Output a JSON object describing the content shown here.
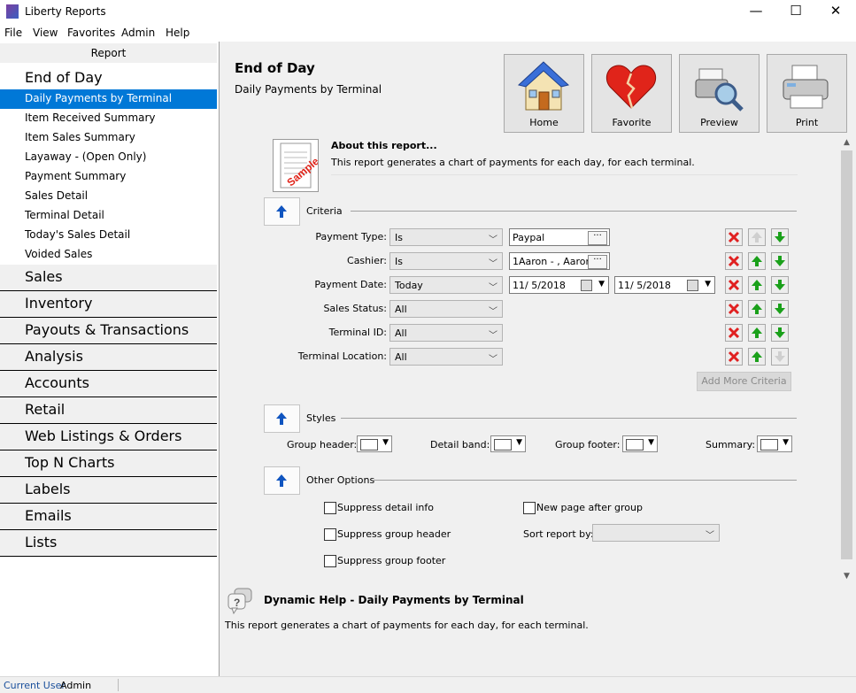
{
  "window": {
    "title": "Liberty Reports",
    "minimize": "—",
    "maximize": "☐",
    "close": "✕"
  },
  "menu": [
    "File",
    "View",
    "Favorites",
    "Admin",
    "Help"
  ],
  "sidebar": {
    "header": "Report",
    "category_open": "End of Day",
    "reports": [
      "Daily Payments by Terminal",
      "Item Received Summary",
      "Item Sales Summary",
      "Layaway - (Open Only)",
      "Payment Summary",
      "Sales Detail",
      "Terminal Detail",
      "Today's Sales Detail",
      "Voided Sales"
    ],
    "categories": [
      "Sales",
      "Inventory",
      "Payouts & Transactions",
      "Analysis",
      "Accounts",
      "Retail",
      "Web Listings & Orders",
      "Top N Charts",
      "Labels",
      "Emails",
      "Lists"
    ]
  },
  "header": {
    "title": "End of Day",
    "subtitle": "Daily Payments by Terminal"
  },
  "toolbar": {
    "home": "Home",
    "favorite": "Favorite",
    "preview": "Preview",
    "print": "Print"
  },
  "about": {
    "image_text": "Sample",
    "title": "About this report...",
    "text": "This report generates a chart of payments for each day, for each terminal."
  },
  "criteria": {
    "label": "Criteria",
    "rows": [
      {
        "label": "Payment Type:",
        "op": "Is",
        "value": "Paypal"
      },
      {
        "label": "Cashier:",
        "op": "Is",
        "value": "1Aaron - , Aaron"
      },
      {
        "label": "Payment Date:",
        "op": "Today",
        "date_from": "11/  5/2018",
        "date_to": "11/  5/2018"
      },
      {
        "label": "Sales Status:",
        "op": "All"
      },
      {
        "label": "Terminal ID:",
        "op": "All"
      },
      {
        "label": "Terminal Location:",
        "op": "All"
      }
    ],
    "add_more": "Add More Criteria"
  },
  "styles": {
    "label": "Styles",
    "group_header": "Group header:",
    "detail_band": "Detail band:",
    "group_footer": "Group footer:",
    "summary": "Summary:"
  },
  "options": {
    "label": "Other Options",
    "suppress_detail": "Suppress detail info",
    "suppress_group_header": "Suppress group header",
    "suppress_group_footer": "Suppress group footer",
    "new_page": "New page after group",
    "sort_by": "Sort report by:",
    "sort_value": ""
  },
  "help": {
    "title": "Dynamic Help - Daily Payments by Terminal",
    "text": "This report generates a chart of payments for each day, for each terminal."
  },
  "status": {
    "user_key": "Current User",
    "user_value": "Admin"
  },
  "colors": {
    "selection": "#0078d7",
    "delete": "#e02020",
    "move": "#1aa01a",
    "up_arrow": "#1055c0"
  }
}
